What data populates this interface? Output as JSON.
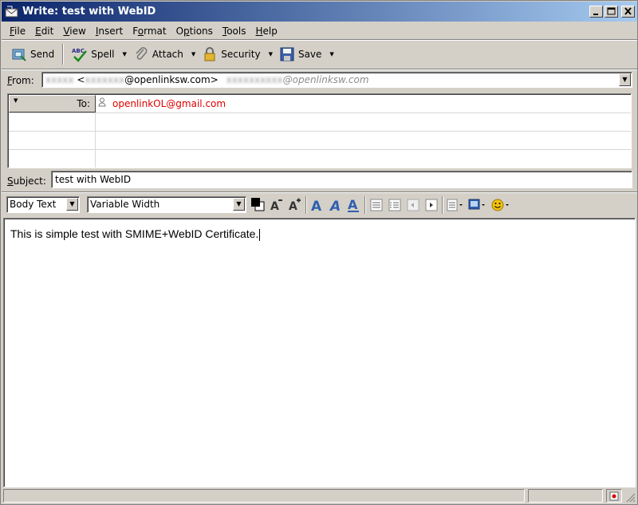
{
  "window": {
    "title": "Write: test with WebID",
    "minimize": "_",
    "maximize": "□",
    "close": "×"
  },
  "menu": [
    {
      "label": "File"
    },
    {
      "label": "Edit"
    },
    {
      "label": "View"
    },
    {
      "label": "Insert"
    },
    {
      "label": "Format"
    },
    {
      "label": "Options"
    },
    {
      "label": "Tools"
    },
    {
      "label": "Help"
    }
  ],
  "toolbar": {
    "send": "Send",
    "spell": "Spell",
    "attach": "Attach",
    "security": "Security",
    "save": "Save"
  },
  "header": {
    "from_label": "From:",
    "from_name_blurred": "xxxxx",
    "from_user_blurred": "xxxxxxx",
    "from_domain": "@openlinksw.com>",
    "from_alt_blurred": "xxxxxxxxxx",
    "from_alt_domain": "@openlinksw.com",
    "to_label": "To:",
    "to_address": "openlinkOL@gmail.com",
    "subject_label": "Subject:",
    "subject_value": "test with WebID"
  },
  "format": {
    "paragraph_style": "Body Text",
    "font": "Variable Width"
  },
  "body": {
    "text": "This is simple test with SMIME+WebID Certificate."
  },
  "colors": {
    "recipient": "#e00000",
    "title_start": "#0a246a",
    "title_end": "#a6caf0"
  }
}
